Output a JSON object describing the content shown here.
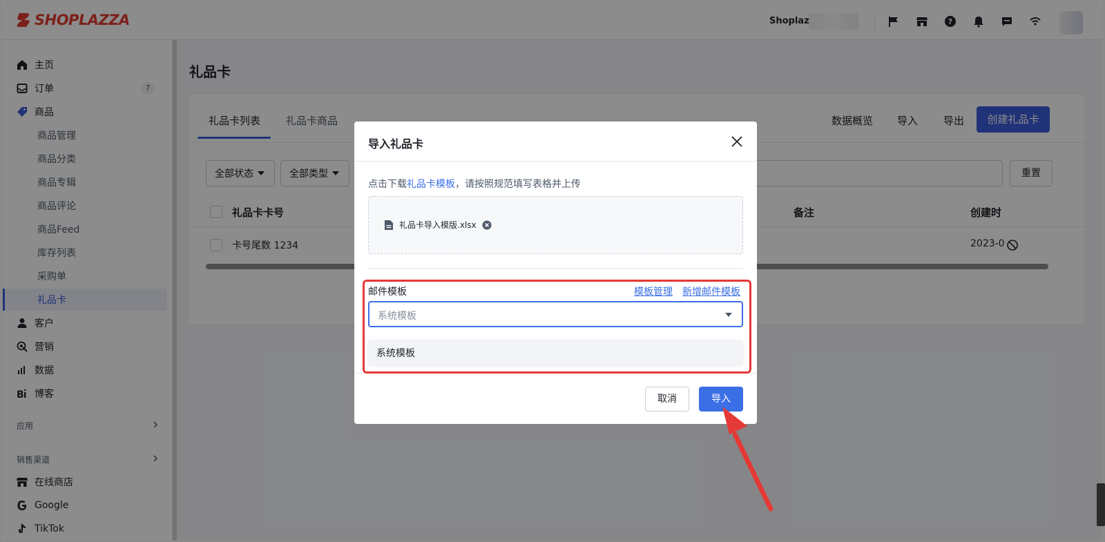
{
  "brand": {
    "name": "SHOPLAZZA",
    "color": "#e03c31"
  },
  "header": {
    "store_name": "Shoplazza",
    "icons": [
      "flag-icon",
      "store-icon",
      "help-icon",
      "bell-icon",
      "message-icon",
      "wifi-icon"
    ]
  },
  "sidebar": {
    "items": [
      {
        "label": "主页",
        "icon": "home-icon"
      },
      {
        "label": "订单",
        "icon": "inbox-icon",
        "badge": "7"
      },
      {
        "label": "商品",
        "icon": "tag-icon"
      }
    ],
    "sub_items": [
      "商品管理",
      "商品分类",
      "商品专辑",
      "商品评论",
      "商品Feed",
      "库存列表",
      "采购单",
      "礼品卡"
    ],
    "items_after": [
      {
        "label": "客户",
        "icon": "user-icon"
      },
      {
        "label": "营销",
        "icon": "marketing-icon"
      },
      {
        "label": "数据",
        "icon": "chart-icon"
      },
      {
        "label": "博客",
        "icon": "blog-icon"
      }
    ],
    "section_apps": "应用",
    "section_channels": "销售渠道",
    "channels": [
      {
        "label": "在线商店",
        "icon": "store-icon"
      },
      {
        "label": "Google",
        "icon": "google-icon"
      },
      {
        "label": "TikTok",
        "icon": "tiktok-icon"
      }
    ]
  },
  "page": {
    "title": "礼品卡",
    "tabs": [
      "礼品卡列表",
      "礼品卡商品"
    ],
    "actions": {
      "overview": "数据概览",
      "import": "导入",
      "export": "导出",
      "create": "创建礼品卡"
    },
    "filters": {
      "status": "全部状态",
      "type": "全部类型",
      "reset": "重置"
    },
    "table": {
      "columns": {
        "card_no": "礼品卡卡号",
        "note": "备注",
        "created": "创建时"
      },
      "rows": [
        {
          "card_no": "卡号尾数 1234",
          "created": "2023-0"
        }
      ]
    }
  },
  "modal": {
    "title": "导入礼品卡",
    "hint_prefix": "点击下载",
    "hint_link": "礼品卡模板",
    "hint_suffix": "，请按照规范填写表格并上传",
    "file_name": "礼品卡导入模版.xlsx",
    "mail_label": "邮件模板",
    "manage_link": "模板管理",
    "add_link": "新增邮件模板",
    "select_placeholder": "系统模板",
    "option": "系统模板",
    "cancel": "取消",
    "import": "导入"
  },
  "colors": {
    "primary": "#3b5bdb",
    "link": "#3b6fe6",
    "annotation": "#e53935"
  }
}
